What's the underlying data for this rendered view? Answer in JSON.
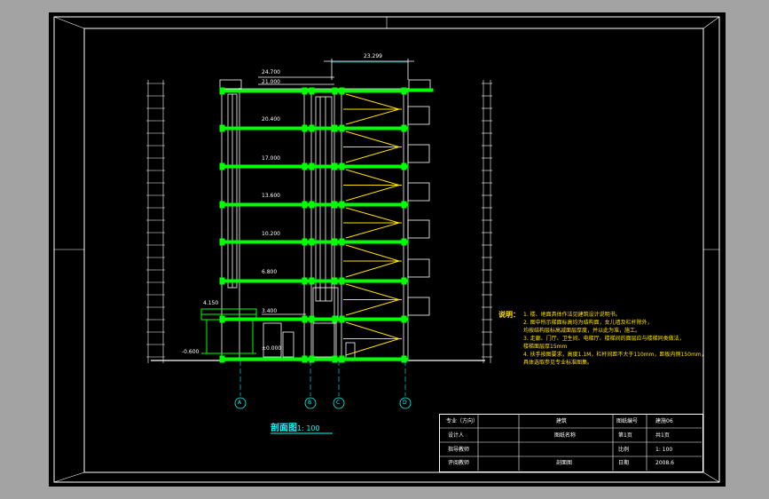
{
  "elevations": {
    "top": "24.700",
    "roof_parapet": "21.000",
    "floor_6": "20.400",
    "floor_5": "17.000",
    "floor_4": "13.600",
    "floor_3": "10.200",
    "floor_2": "6.800",
    "canopy": "4.150",
    "floor_1": "3.400",
    "ground": "±0.000",
    "outdoor": "-0.600",
    "width_dim": "23.299"
  },
  "axes": [
    "A",
    "B",
    "C",
    "D"
  ],
  "section_title": "剖面图",
  "section_scale": "1: 100",
  "notes": {
    "heading": "说明：",
    "lines": [
      "1. 楼、地面具体作法见建筑设计说明书。",
      "2. 图中所示梯面标高均为结构面，女儿墙及栏杆除外，",
      "   均按结构层标高减面层厚度，并以此为准，施工。",
      "3. 走廊、门厅、卫生间、电梯厅、楼梯间的面层应与楼梯同类做法，",
      "   楼梯面层厚15mm",
      "4. 扶手按图要求，高度1.1M，栏杆间距不大于110mm，距板内侧150mm，",
      "   具体选取参见专业标准图集。"
    ]
  },
  "titleblock": {
    "r1": [
      "专业（方向）",
      "",
      "建筑",
      "图纸编号",
      "建施06"
    ],
    "r2": [
      "设计人",
      "",
      "图纸名称",
      "",
      "第1页",
      "共1页"
    ],
    "r3": [
      "指导教师",
      "",
      "",
      "",
      "比例",
      "1: 100"
    ],
    "r4": [
      "评阅教师",
      "",
      "剖面图",
      "",
      "日期",
      "2008.6"
    ]
  },
  "colors": {
    "background": "#000000",
    "frame": "#ffffff",
    "structure": "#00ff00",
    "stair": "#ffe000",
    "axis": "#00ffff",
    "outer": "#a3a3a3"
  }
}
